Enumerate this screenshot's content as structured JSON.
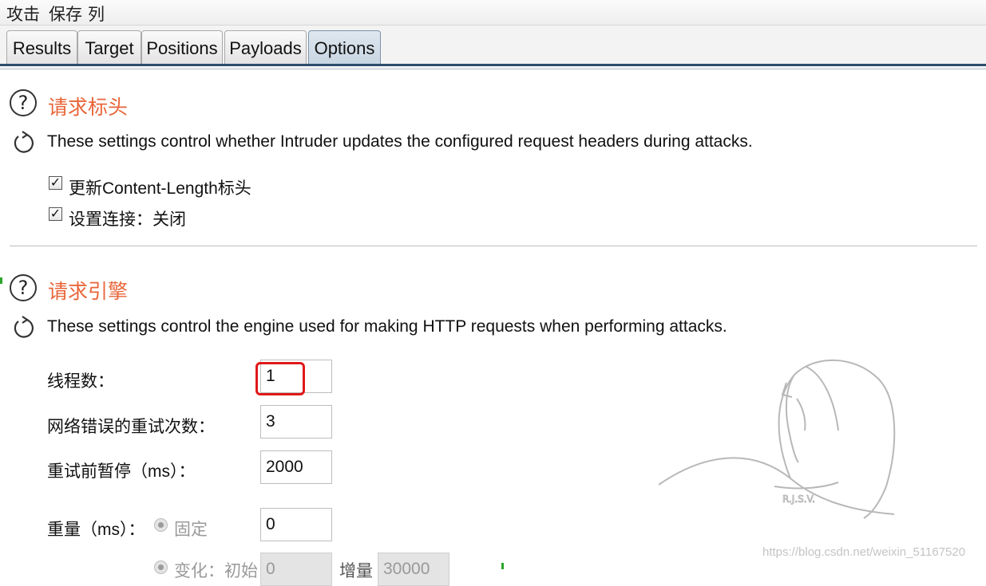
{
  "menubar": {
    "items": [
      "攻击",
      "保存",
      "列"
    ]
  },
  "tabs": [
    {
      "label": "Results"
    },
    {
      "label": "Target"
    },
    {
      "label": "Positions"
    },
    {
      "label": "Payloads"
    },
    {
      "label": "Options",
      "active": true
    }
  ],
  "request_headers": {
    "title": "请求标头",
    "description": "These settings control whether Intruder updates the configured request headers during attacks.",
    "options": [
      {
        "label": "更新Content-Length标头",
        "checked": true
      },
      {
        "label": "设置连接：关闭",
        "checked": true
      }
    ]
  },
  "request_engine": {
    "title": "请求引擎",
    "description": "These settings control the engine used for making HTTP requests when performing attacks.",
    "threads": {
      "label": "线程数：",
      "value": "1"
    },
    "network_retries": {
      "label": "网络错误的重试次数：",
      "value": "3"
    },
    "retry_pause": {
      "label": "重试前暂停（ms）：",
      "value": "2000"
    },
    "throttle": {
      "label": "重量（ms）：",
      "fixed_label": "固定",
      "fixed_value": "0",
      "variable_label": "变化：初始",
      "variable_start": "0",
      "step_label": "增量",
      "step_value": "30000"
    }
  },
  "watermark": {
    "logo_text": "R.J.S.V.",
    "url": "https://blog.csdn.net/weixin_51167520"
  },
  "colors": {
    "section_title": "#e8663a",
    "highlight": "#e01818",
    "tab_active": "#c7d5e2"
  }
}
